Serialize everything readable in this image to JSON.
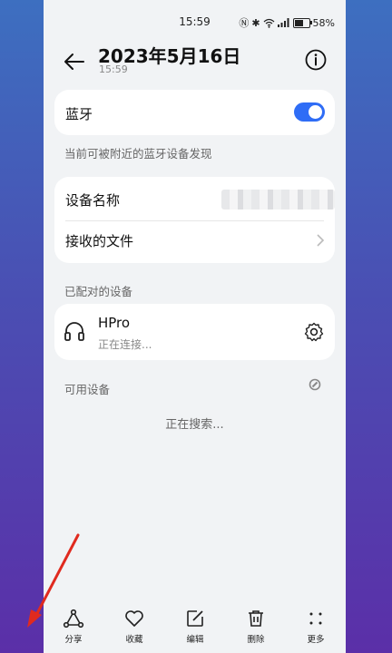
{
  "status_bar": {
    "time": "15:59",
    "battery": "58%"
  },
  "header": {
    "title": "2023年5月16日",
    "subtitle": "15:59"
  },
  "bluetooth": {
    "label": "蓝牙",
    "enabled": true,
    "discoverable_text": "当前可被附近的蓝牙设备发现"
  },
  "device": {
    "name_label": "设备名称",
    "received_label": "接收的文件"
  },
  "paired": {
    "section": "已配对的设备",
    "device_name": "HPro",
    "device_status": "正在连接..."
  },
  "available": {
    "section": "可用设备",
    "searching": "正在搜索..."
  },
  "toolbar": {
    "share": "分享",
    "favorite": "收藏",
    "edit": "编辑",
    "delete": "删除",
    "more": "更多"
  },
  "colors": {
    "accent": "#2f6df6",
    "arrow": "#e02a1f"
  }
}
